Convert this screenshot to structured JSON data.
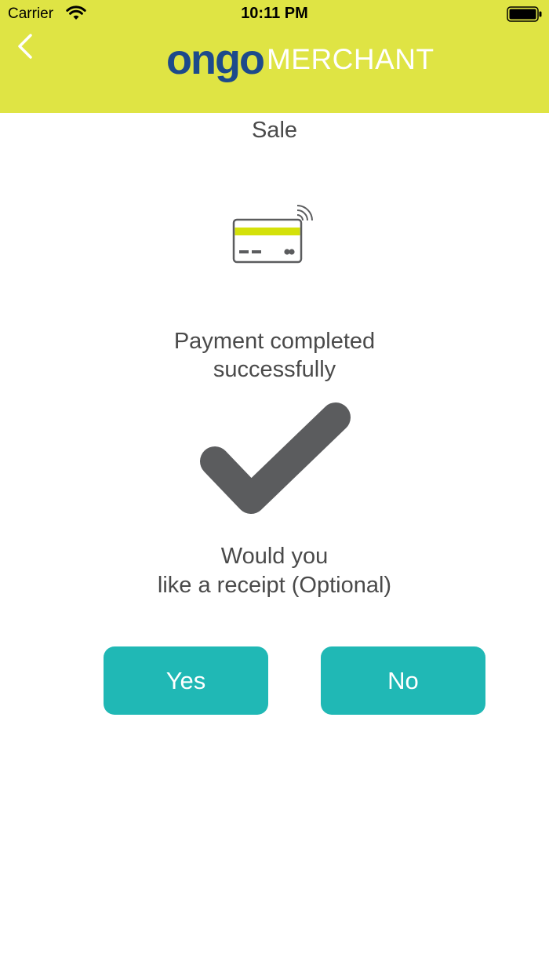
{
  "status_bar": {
    "carrier": "Carrier",
    "time": "10:11 PM"
  },
  "header": {
    "brand": "ongo",
    "product": "MERCHANT",
    "back_icon": "chevron-left-icon",
    "background_color": "#dfe444",
    "brand_color": "#1d4a8b"
  },
  "main": {
    "title": "Sale",
    "card_icon": "contactless-card-icon",
    "message_line1": "Payment completed",
    "message_line2": "successfully",
    "success_icon": "checkmark-icon",
    "question_line1": "Would you",
    "question_line2": "like a receipt (Optional)"
  },
  "actions": {
    "yes_label": "Yes",
    "no_label": "No",
    "button_color": "#20b8b5"
  }
}
